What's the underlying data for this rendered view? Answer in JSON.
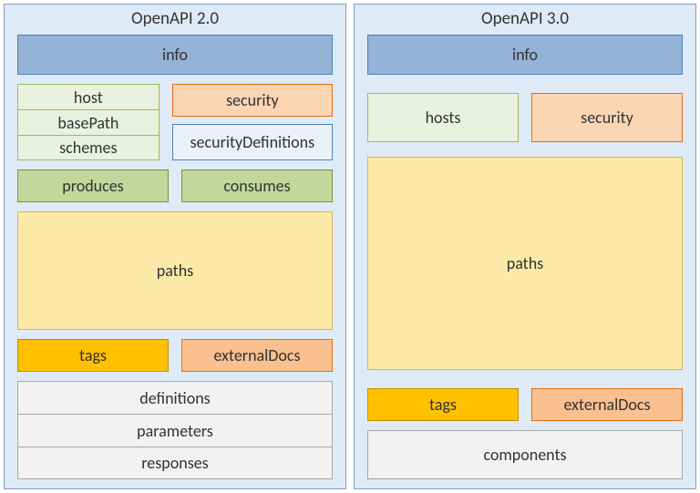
{
  "left": {
    "title": "OpenAPI 2.0",
    "info": "info",
    "hostGroup": {
      "host": "host",
      "basePath": "basePath",
      "schemes": "schemes"
    },
    "security": "security",
    "securityDefinitions": "securityDefinitions",
    "produces": "produces",
    "consumes": "consumes",
    "paths": "paths",
    "tags": "tags",
    "externalDocs": "externalDocs",
    "defs": {
      "definitions": "definitions",
      "parameters": "parameters",
      "responses": "responses"
    }
  },
  "right": {
    "title": "OpenAPI 3.0",
    "info": "info",
    "hosts": "hosts",
    "security": "security",
    "paths": "paths",
    "tags": "tags",
    "externalDocs": "externalDocs",
    "components": "components"
  }
}
